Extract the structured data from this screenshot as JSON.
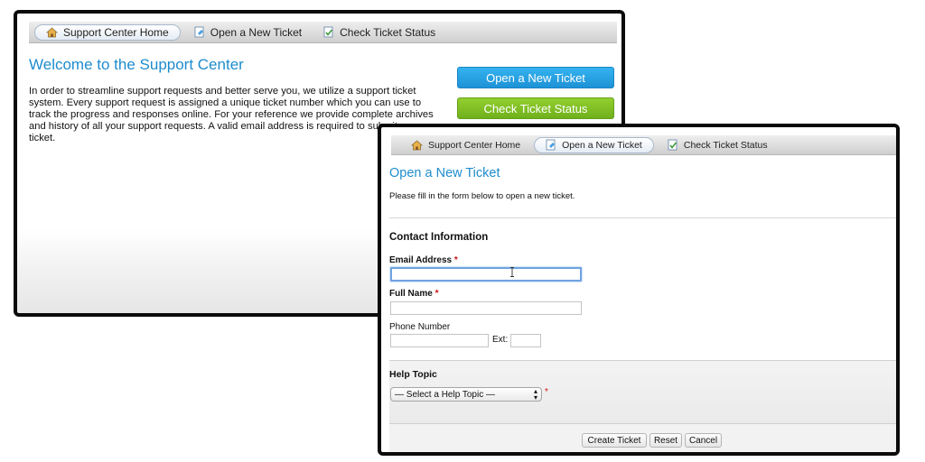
{
  "nav": {
    "home": "Support Center Home",
    "open": "Open a New Ticket",
    "status": "Check Ticket Status"
  },
  "home_page": {
    "title": "Welcome to the Support Center",
    "intro_lines": [
      "In order to streamline support requests and better serve you, we utilize a support ticket",
      "system. Every support request is assigned a unique ticket number which you can use to",
      "track the progress and responses online. For your reference we provide complete archives",
      "and history of all your support requests. A valid email address is required to submit a",
      "ticket."
    ],
    "open_button": "Open a New Ticket",
    "status_button": "Check Ticket Status"
  },
  "ticket_form": {
    "title": "Open a New Ticket",
    "subtitle": "Please fill in the form below to open a new ticket.",
    "contact_heading": "Contact Information",
    "email_label": "Email Address",
    "email_value": "",
    "fullname_label": "Full Name",
    "fullname_value": "",
    "phone_label": "Phone Number",
    "phone_value": "",
    "ext_label": "Ext:",
    "ext_value": "",
    "required_mark": "*",
    "help_topic_heading": "Help Topic",
    "help_topic_selected": "— Select a Help Topic —",
    "buttons": {
      "create": "Create Ticket",
      "reset": "Reset",
      "cancel": "Cancel"
    }
  },
  "colors": {
    "accent_blue": "#1e8ccd",
    "open_button": "#2aa6e8",
    "status_button": "#7fc025",
    "required": "#cc1111"
  }
}
